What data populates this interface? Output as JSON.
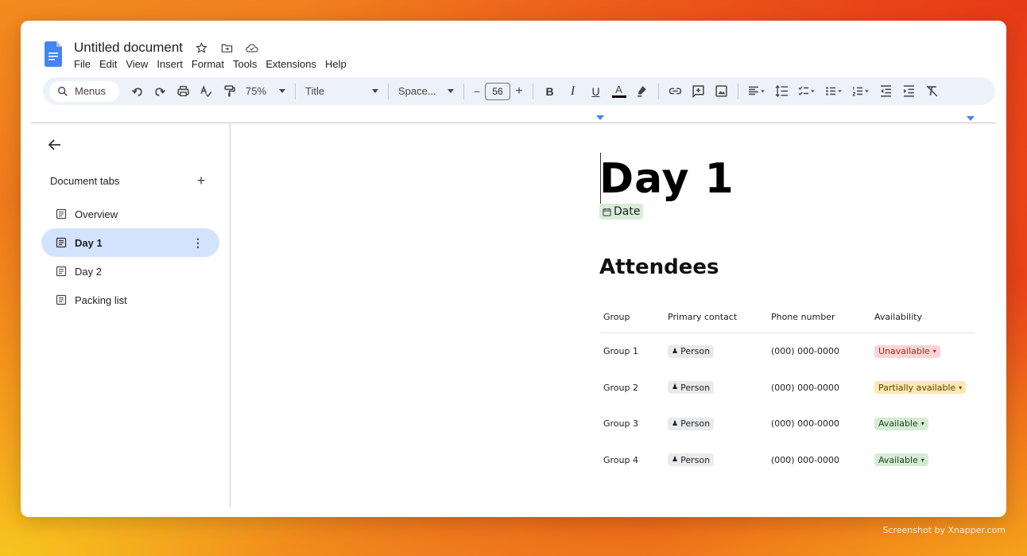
{
  "header": {
    "title": "Untitled document",
    "menus": [
      "File",
      "Edit",
      "View",
      "Insert",
      "Format",
      "Tools",
      "Extensions",
      "Help"
    ]
  },
  "toolbar": {
    "search_label": "Menus",
    "zoom": "75%",
    "style": "Title",
    "font": "Space...",
    "font_size": "56",
    "bold": "B",
    "italic": "I",
    "underline": "U",
    "text_color_glyph": "A",
    "minus": "–",
    "plus": "+"
  },
  "sidebar": {
    "header": "Document tabs",
    "add_glyph": "+",
    "tabs": [
      {
        "label": "Overview",
        "active": false
      },
      {
        "label": "Day 1",
        "active": true
      },
      {
        "label": "Day 2",
        "active": false
      },
      {
        "label": "Packing list",
        "active": false
      }
    ]
  },
  "document": {
    "heading": "Day 1",
    "date_chip": "Date",
    "section_heading": "Attendees",
    "table": {
      "headers": [
        "Group",
        "Primary contact",
        "Phone number",
        "Availability"
      ],
      "rows": [
        {
          "group": "Group 1",
          "contact": "Person",
          "phone": "(000) 000-0000",
          "availability": "Unavailable",
          "status": "red"
        },
        {
          "group": "Group 2",
          "contact": "Person",
          "phone": "(000) 000-0000",
          "availability": "Partially available",
          "status": "yellow"
        },
        {
          "group": "Group 3",
          "contact": "Person",
          "phone": "(000) 000-0000",
          "availability": "Available",
          "status": "green"
        },
        {
          "group": "Group 4",
          "contact": "Person",
          "phone": "(000) 000-0000",
          "availability": "Available",
          "status": "green"
        }
      ]
    }
  },
  "watermark": "Screenshot by Xnapper.com",
  "colors": {
    "accent": "#4285f4",
    "active_tab": "#d3e3fd",
    "toolbar_bg": "#edf2fa",
    "status_red": "#fbd4d4",
    "status_yellow": "#fce8b2",
    "status_green": "#d5ecd4"
  }
}
